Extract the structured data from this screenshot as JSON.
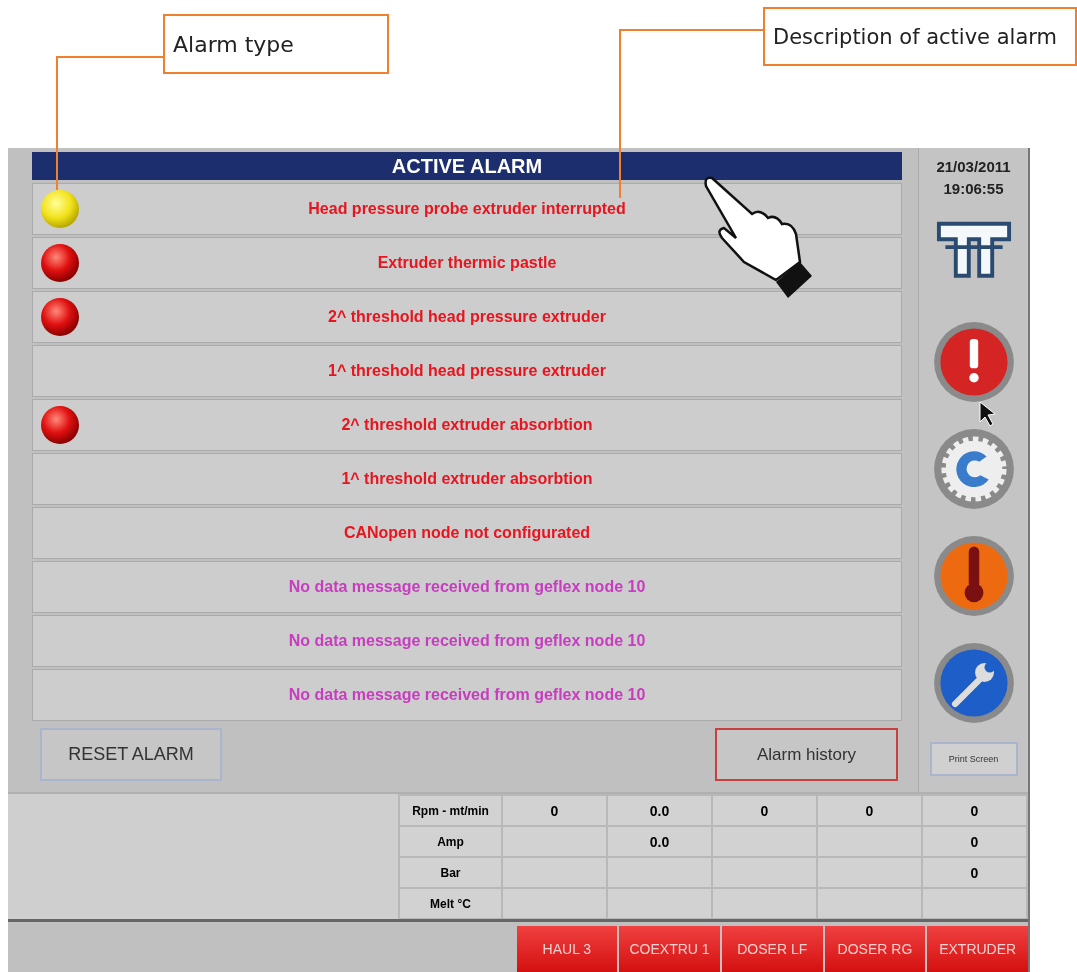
{
  "callouts": [
    {
      "text": "Alarm type"
    },
    {
      "text": "Description of active alarm"
    }
  ],
  "header": {
    "title": "ACTIVE ALARM"
  },
  "alarms": [
    {
      "kind": "warning",
      "text": "Head pressure probe extruder interrupted",
      "color": "#e8141e"
    },
    {
      "kind": "alarm",
      "text": "Extruder thermic pastle",
      "color": "#e8141e"
    },
    {
      "kind": "alarm",
      "text": "2^ threshold head pressure extruder",
      "color": "#e8141e"
    },
    {
      "kind": "none",
      "text": "1^ threshold head pressure extruder",
      "color": "#e8141e"
    },
    {
      "kind": "alarm",
      "text": "2^ threshold extruder absorbtion",
      "color": "#e8141e"
    },
    {
      "kind": "none",
      "text": "1^ threshold extruder absorbtion",
      "color": "#e8141e"
    },
    {
      "kind": "none",
      "text": "CANopen node not configurated",
      "color": "#e8141e"
    },
    {
      "kind": "none",
      "text": "No data message received from geflex node 10",
      "color": "#c83cc0"
    },
    {
      "kind": "none",
      "text": "No data message received from geflex node 10",
      "color": "#c83cc0"
    },
    {
      "kind": "none",
      "text": "No data message received from geflex node 10",
      "color": "#c83cc0"
    }
  ],
  "buttons": {
    "reset": "RESET ALARM",
    "history": "Alarm history"
  },
  "sidebar": {
    "date": "21/03/2011",
    "time": "19:06:55",
    "print": "Print Screen"
  },
  "table": {
    "rows": [
      {
        "label": "Rpm - mt/min",
        "cells": [
          "0",
          "0.0",
          "0",
          "0",
          "0"
        ]
      },
      {
        "label": "Amp",
        "cells": [
          null,
          "0.0",
          null,
          null,
          "0"
        ]
      },
      {
        "label": "Bar",
        "cells": [
          null,
          null,
          null,
          null,
          "0"
        ]
      },
      {
        "label": "Melt °C",
        "cells": [
          null,
          null,
          null,
          null,
          null
        ]
      }
    ]
  },
  "tabs": [
    {
      "label": "HAUL 3"
    },
    {
      "label": "COEXTRU 1"
    },
    {
      "label": "DOSER LF"
    },
    {
      "label": "DOSER RG"
    },
    {
      "label": "EXTRUDER"
    }
  ]
}
